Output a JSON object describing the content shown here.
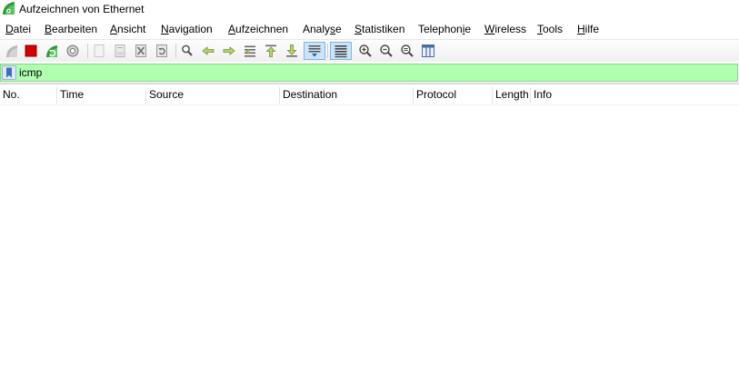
{
  "window": {
    "title": "Aufzeichnen von Ethernet"
  },
  "menu": {
    "items": [
      {
        "label": "Datei",
        "mnemonic": "D",
        "rest": "atei"
      },
      {
        "label": "Bearbeiten",
        "mnemonic": "B",
        "rest": "earbeiten"
      },
      {
        "label": "Ansicht",
        "mnemonic": "A",
        "rest": "nsicht"
      },
      {
        "label": "Navigation",
        "mnemonic": "N",
        "rest": "avigation"
      },
      {
        "label": "Aufzeichnen",
        "mnemonic": "A",
        "rest": "ufzeichnen"
      },
      {
        "label": "Analyse",
        "pre": "Analy",
        "mnemonic": "s",
        "rest": "e"
      },
      {
        "label": "Statistiken",
        "mnemonic": "S",
        "rest": "tatistiken"
      },
      {
        "label": "Telephonie",
        "pre": "Telephon",
        "mnemonic": "i",
        "rest": "e"
      },
      {
        "label": "Wireless",
        "mnemonic": "W",
        "rest": "ireless"
      },
      {
        "label": "Tools",
        "mnemonic": "T",
        "rest": "ools"
      },
      {
        "label": "Hilfe",
        "mnemonic": "H",
        "rest": "ilfe"
      }
    ]
  },
  "toolbar": {
    "icons": [
      "start-capture-icon",
      "stop-capture-icon",
      "restart-capture-icon",
      "capture-options-icon",
      "open-file-icon",
      "save-file-icon",
      "close-file-icon",
      "reload-file-icon",
      "find-packet-icon",
      "go-back-icon",
      "go-forward-icon",
      "go-to-packet-icon",
      "go-first-icon",
      "go-last-icon",
      "autoscroll-icon",
      "colorize-icon",
      "zoom-in-icon",
      "zoom-out-icon",
      "zoom-normal-icon",
      "resize-columns-icon"
    ],
    "active": [
      "autoscroll-icon",
      "colorize-icon"
    ]
  },
  "filter": {
    "value": "icmp",
    "background": "#afffaf"
  },
  "packet_list": {
    "columns": [
      "No.",
      "Time",
      "Source",
      "Destination",
      "Protocol",
      "Length",
      "Info"
    ],
    "rows": []
  }
}
